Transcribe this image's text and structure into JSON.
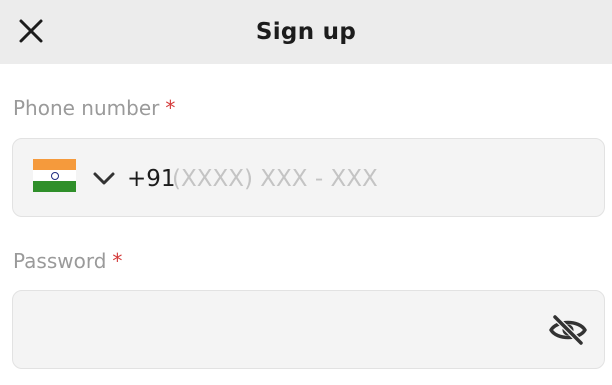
{
  "header": {
    "title": "Sign up",
    "close_icon": "close-icon"
  },
  "phone": {
    "label": "Phone number",
    "required_mark": "*",
    "country_flag": "india-flag-icon",
    "dropdown_icon": "chevron-down-icon",
    "country_code": "+91",
    "placeholder": "(XXXX) XXX - XXX",
    "value": ""
  },
  "password": {
    "label": "Password",
    "required_mark": "*",
    "value": "",
    "visibility_icon": "eye-off-icon"
  },
  "colors": {
    "header_bg": "#ececec",
    "field_bg": "#f4f4f4",
    "required": "#d43a3a",
    "label": "#9a9a9a",
    "placeholder": "#c4c4c4"
  }
}
